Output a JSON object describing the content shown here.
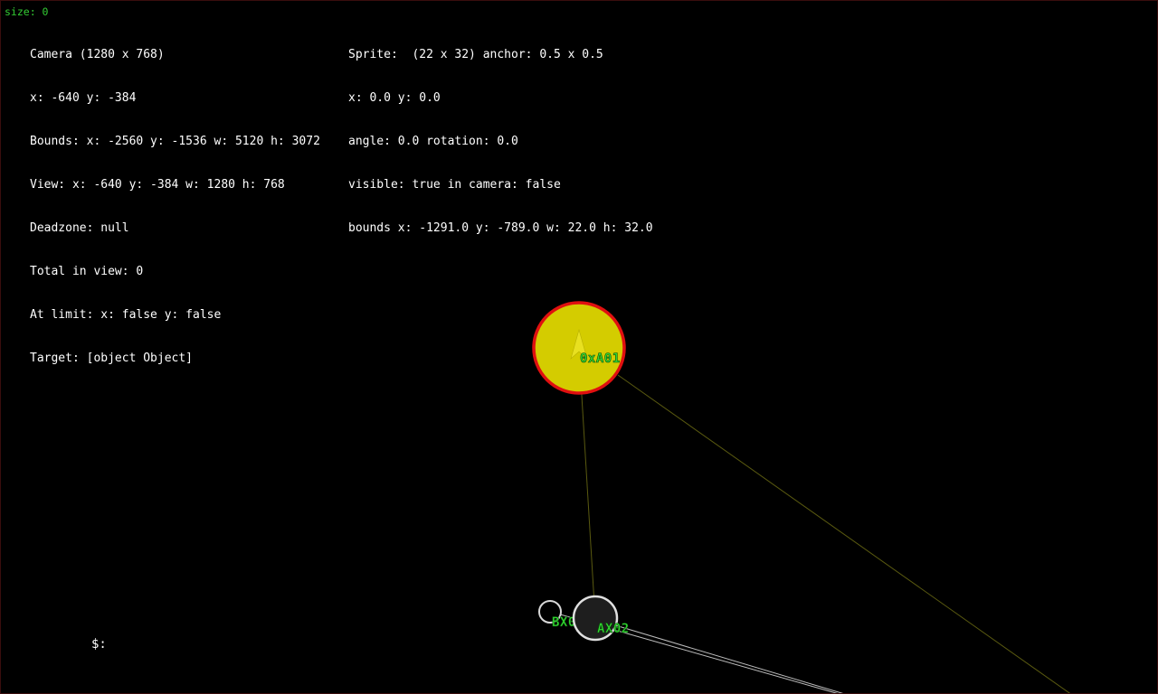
{
  "hud": {
    "size_label": "size: 0",
    "camera_lines": [
      "Camera (1280 x 768)",
      "x: -640 y: -384",
      "Bounds: x: -2560 y: -1536 w: 5120 h: 3072",
      "View: x: -640 y: -384 w: 1280 h: 768",
      "Deadzone: null",
      "Total in view: 0",
      "At limit: x: false y: false",
      "Target: [object Object]"
    ],
    "sprite_lines": [
      "Sprite:  (22 x 32) anchor: 0.5 x 0.5",
      "x: 0.0 y: 0.0",
      "angle: 0.0 rotation: 0.0",
      "visible: true in camera: false",
      "bounds x: -1291.0 y: -789.0 w: 22.0 h: 32.0"
    ]
  },
  "nodes": {
    "player": {
      "label": "0xA01",
      "fill": "#d4cc00",
      "ring": "#e01010",
      "ship": "#e8e020"
    },
    "bx02": {
      "label": "BX02",
      "fill": "#000000",
      "ring": "#d8d8d8"
    },
    "ax02": {
      "label": "AX02",
      "fill": "#1e1e1e",
      "ring": "#e0e0e0"
    }
  },
  "links": {
    "player_link_color": "#5a5a10",
    "node_link_color": "#bdbdbd"
  },
  "console": {
    "prompt": "$:",
    "value": ""
  }
}
